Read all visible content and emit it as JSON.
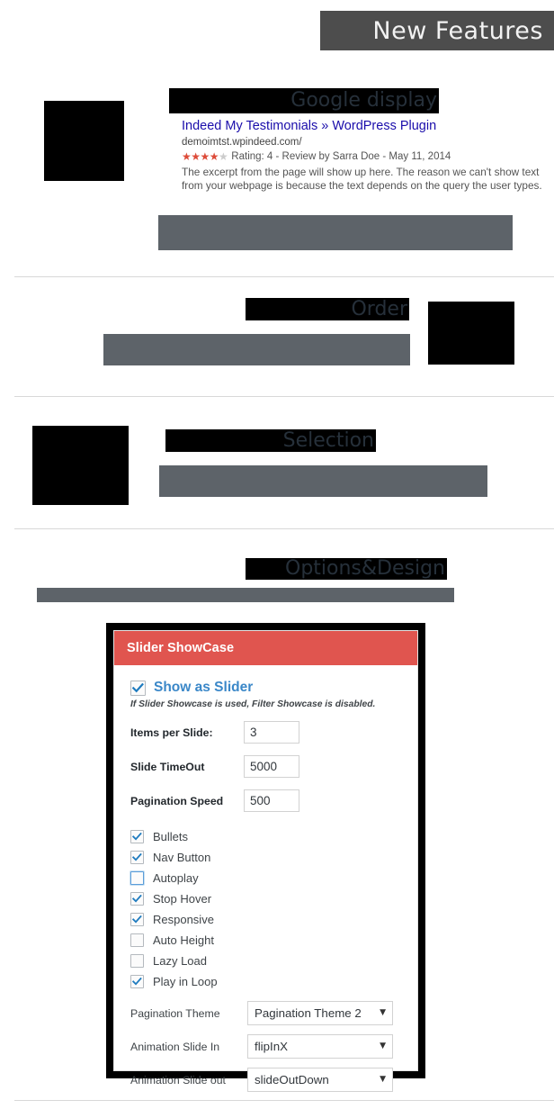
{
  "banner": {
    "title": "New Features"
  },
  "sections": [
    {
      "label": "Google display"
    },
    {
      "label": "Order"
    },
    {
      "label": "Selection"
    },
    {
      "label": "Options&Design"
    }
  ],
  "serp": {
    "title": "Indeed My Testimonials » WordPress Plugin",
    "url": "demoimtst.wpindeed.com/",
    "stars_filled": "★★★★",
    "stars_empty": "★",
    "rating_text": "Rating: 4 - Review by Sarra Doe - May 11, 2014",
    "description": "The excerpt from the page will show up here. The reason we can't show text from your webpage is because the text depends on the query the user types."
  },
  "panel": {
    "title": "Slider ShowCase",
    "show_as_slider_label": "Show as Slider",
    "show_as_slider_checked": true,
    "hint": "If Slider Showcase is used, Filter Showcase is disabled.",
    "fields": [
      {
        "label": "Items per Slide:",
        "value": "3"
      },
      {
        "label": "Slide TimeOut",
        "value": "5000"
      },
      {
        "label": "Pagination Speed",
        "value": "500"
      }
    ],
    "checkboxes": [
      {
        "label": "Bullets",
        "checked": true,
        "focused": false
      },
      {
        "label": "Nav Button",
        "checked": true,
        "focused": false
      },
      {
        "label": "Autoplay",
        "checked": false,
        "focused": true
      },
      {
        "label": "Stop Hover",
        "checked": true,
        "focused": false
      },
      {
        "label": "Responsive",
        "checked": true,
        "focused": false
      },
      {
        "label": "Auto Height",
        "checked": false,
        "focused": false
      },
      {
        "label": "Lazy Load",
        "checked": false,
        "focused": false
      },
      {
        "label": "Play in Loop",
        "checked": true,
        "focused": false
      }
    ],
    "selects": [
      {
        "label": "Pagination Theme",
        "value": "Pagination Theme 2",
        "caret": "▼"
      },
      {
        "label": "Animation Slide In",
        "value": "flipInX",
        "caret": "▼"
      },
      {
        "label": "Animation Slide out",
        "value": "slideOutDown",
        "caret": "▼"
      }
    ]
  },
  "colors": {
    "banner_bg": "#4d4d4d",
    "gray_bar": "#5d6369",
    "panel_accent": "#e0554f",
    "link_blue": "#1a0dab",
    "checkbox_blue": "#3a87c8",
    "star": "#dd4b39"
  }
}
